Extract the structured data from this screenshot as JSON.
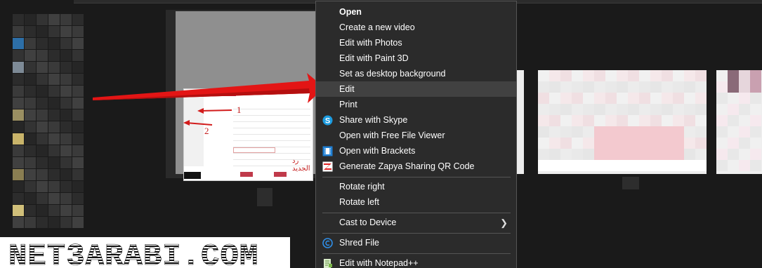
{
  "menu": {
    "items": [
      {
        "label": "Open",
        "bold": true
      },
      {
        "label": "Create a new video"
      },
      {
        "label": "Edit with Photos"
      },
      {
        "label": "Edit with Paint 3D"
      },
      {
        "label": "Set as desktop background"
      },
      {
        "label": "Edit",
        "highlighted": true
      },
      {
        "label": "Print"
      },
      {
        "label": "Share with Skype",
        "icon": "skype-icon"
      },
      {
        "label": "Open with Free File Viewer"
      },
      {
        "label": "Open with Brackets",
        "icon": "brackets-icon"
      },
      {
        "label": "Generate Zapya Sharing QR Code",
        "icon": "zapya-icon"
      },
      {
        "label": "Rotate right"
      },
      {
        "label": "Rotate left"
      },
      {
        "label": "Cast to Device",
        "submenu": true
      },
      {
        "label": "Shred File",
        "icon": "shred-icon"
      },
      {
        "label": "Edit with Notepad++",
        "icon": "notepad-plus-plus-icon"
      }
    ]
  },
  "thumbnail": {
    "annotation_1": "1",
    "annotation_2": "2",
    "arabic_text": "رد الجديد"
  },
  "watermark": {
    "text": "NET3ARABI.COM"
  },
  "colors": {
    "menu_bg": "#2b2b2b",
    "menu_highlight": "#414141",
    "arrow_red": "#e31515",
    "brand_red": "#bf1e44"
  }
}
